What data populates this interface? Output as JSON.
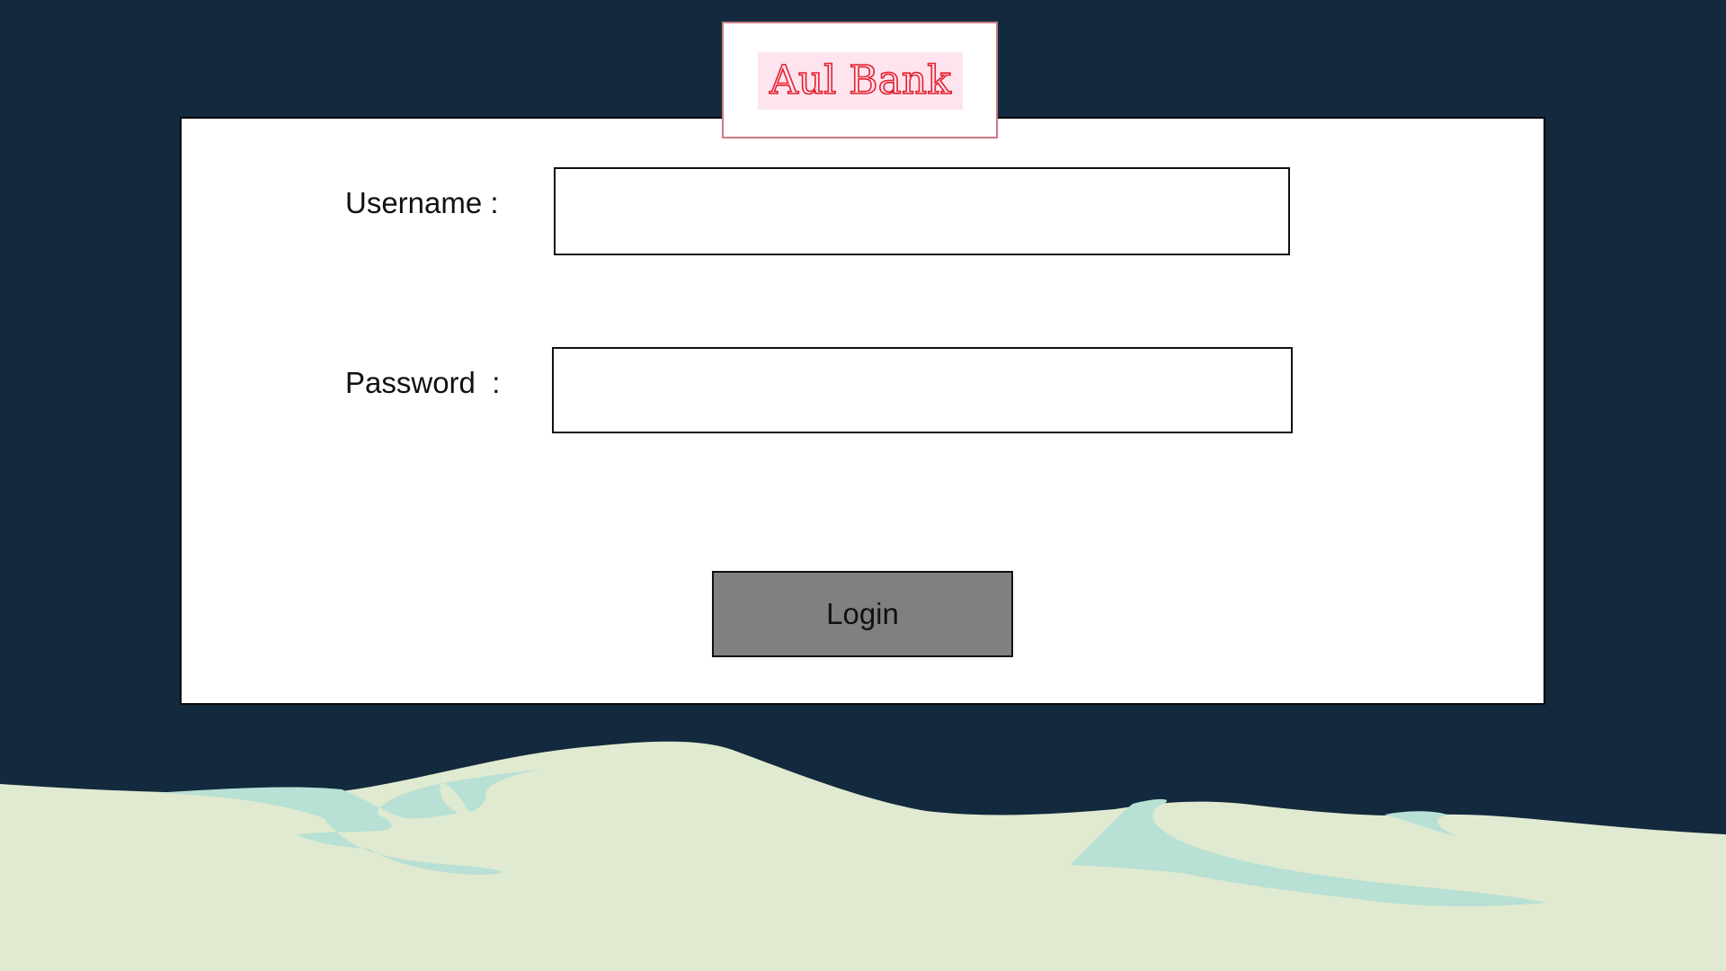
{
  "brand": {
    "name": "Aul Bank",
    "text_color": "#e5202e",
    "background_color": "#fde4ef"
  },
  "form": {
    "username_label": "Username :",
    "username_value": "",
    "password_label": "Password  :",
    "password_value": "",
    "login_label": "Login"
  },
  "colors": {
    "page_background": "#13293d",
    "card_background": "#ffffff",
    "button_background": "#808080",
    "hill_color": "#e0ead0",
    "water_color": "#b8e0d4"
  }
}
